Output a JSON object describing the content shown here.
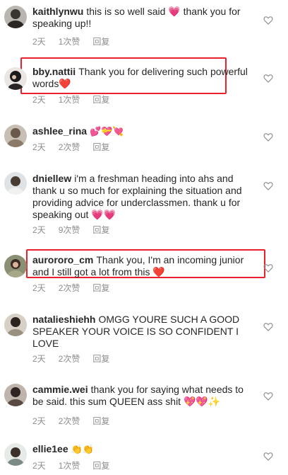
{
  "comments": [
    {
      "user": "kaithlynwu",
      "text": "this is so well said 💗  thank you for speaking up!!",
      "time": "2天",
      "likes": "1次赞",
      "reply": "回复"
    },
    {
      "user": "bby.nattii",
      "text": "Thank you for delivering such powerful words❤️",
      "time": "2天",
      "likes": "1次赞",
      "reply": "回复"
    },
    {
      "user": "ashlee_rina",
      "text": "💕💝💘",
      "time": "2天",
      "likes": "2次赞",
      "reply": "回复"
    },
    {
      "user": "dniellew",
      "text": "i'm a freshman heading into ahs and thank u so much for explaining the situation and providing advice for underclassmen. thank u for speaking out 💗💗",
      "time": "2天",
      "likes": "9次赞",
      "reply": "回复"
    },
    {
      "user": "aurororo_cm",
      "text": "Thank you, I'm an incoming junior and I still got a lot from this ❤️",
      "time": "2天",
      "likes": "2次赞",
      "reply": "回复"
    },
    {
      "user": "natalieshiehh",
      "text": "OMGG YOURE SUCH A GOOD SPEAKER YOUR VOICE IS SO CONFIDENT I LOVE",
      "time": "2天",
      "likes": "2次赞",
      "reply": "回复"
    },
    {
      "user": "cammie.wei",
      "text": "thank you for saying what needs to be said. this sum QUEEN ass shit 💖💖✨",
      "time": "2天",
      "likes": "2次赞",
      "reply": "回复"
    },
    {
      "user": "ellie1ee",
      "text": "👏👏",
      "time": "2天",
      "likes": "1次赞",
      "reply": "回复"
    }
  ],
  "icons": {
    "like": "heart-outline-icon",
    "avatar": "avatar-photo"
  },
  "colors": {
    "highlight": "#e8212b",
    "meta_text": "#8e8e8e",
    "text": "#262626"
  }
}
